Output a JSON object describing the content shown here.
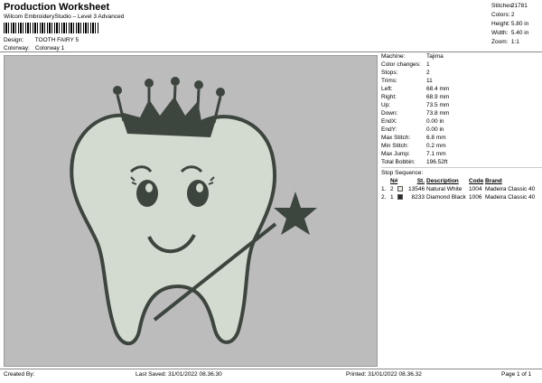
{
  "header": {
    "title": "Production Worksheet",
    "subtitle": "Wilcom EmbroideryStudio – Level 3 Advanced",
    "design_label": "Design:",
    "design_value": "TOOTH FAIRY 5",
    "colorway_label": "Colorway:",
    "colorway_value": "Colorway 1"
  },
  "stats": [
    {
      "label": "Stitches:",
      "value": "21781"
    },
    {
      "label": "Colors:",
      "value": "2"
    },
    {
      "label": "Height:",
      "value": "5.80 in"
    },
    {
      "label": "Width:",
      "value": "5.40 in"
    },
    {
      "label": "Zoom:",
      "value": "1:1"
    }
  ],
  "machine_info": [
    {
      "label": "Machine:",
      "value": "Tajima"
    },
    {
      "label": "Color changes:",
      "value": "1"
    },
    {
      "label": "Stops:",
      "value": "2"
    },
    {
      "label": "Trims:",
      "value": "11"
    },
    {
      "label": "Left:",
      "value": "68.4 mm"
    },
    {
      "label": "Right:",
      "value": "68.9 mm"
    },
    {
      "label": "Up:",
      "value": "73.5 mm"
    },
    {
      "label": "Down:",
      "value": "73.8 mm"
    },
    {
      "label": "EndX:",
      "value": "0.00 in"
    },
    {
      "label": "EndY:",
      "value": "0.00 in"
    },
    {
      "label": "Max Stitch:",
      "value": "6.8 mm"
    },
    {
      "label": "Min Stitch:",
      "value": "0.2 mm"
    },
    {
      "label": "Max Jump:",
      "value": "7.1 mm"
    },
    {
      "label": "Total Bobbin:",
      "value": "196.52ft"
    }
  ],
  "stop_sequence": {
    "title": "Stop Sequence:",
    "headers": {
      "n": "N#",
      "st": "St.",
      "description": "Description",
      "code": "Code",
      "brand": "Brand"
    },
    "rows": [
      {
        "idx": "1.",
        "n": "2",
        "color": "#e6ece0",
        "st": "13546",
        "description": "Natural White",
        "code": "1004",
        "brand": "Madeira Classic 40"
      },
      {
        "idx": "2.",
        "n": "1",
        "color": "#2a2a2a",
        "st": "8233",
        "description": "Diamond Black",
        "code": "1006",
        "brand": "Madeira Classic 40"
      }
    ]
  },
  "footer": {
    "created_by": "Created By:",
    "last_saved": "Last Saved: 31/01/2022 08.36.30",
    "printed": "Printed: 31/01/2022 08.36.32",
    "page": "Page 1 of 1"
  },
  "colors": {
    "canvas_bg": "#bcbcbc",
    "fill": "#d3dbd0",
    "outline": "#3d453f"
  }
}
